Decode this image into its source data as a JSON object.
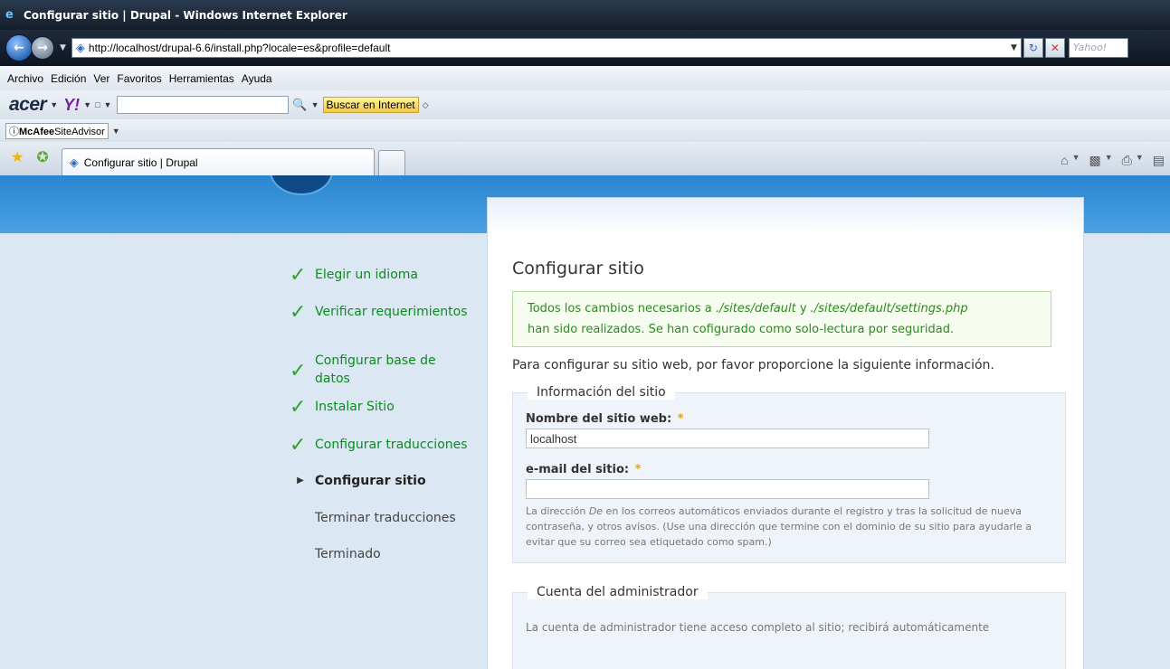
{
  "window": {
    "title": "Configurar sitio | Drupal - Windows Internet Explorer",
    "address": "http://localhost/drupal-6.6/install.php?locale=es&profile=default",
    "search_placeholder": "Yahoo!"
  },
  "menu": {
    "items": [
      "Archivo",
      "Edición",
      "Ver",
      "Favoritos",
      "Herramientas",
      "Ayuda"
    ]
  },
  "toolbar": {
    "acer_label": "acer",
    "yahoo_label": "Y!",
    "search_button": "Buscar en Internet",
    "mcafee_label": "McAfee",
    "mcafee_sub": "SiteAdvisor"
  },
  "tabs": {
    "active_label": "Configurar sitio | Drupal"
  },
  "steps": [
    {
      "label": "Elegir un idioma",
      "state": "done"
    },
    {
      "label": "Verificar requerimientos",
      "state": "done"
    },
    {
      "label": "Configurar base de datos",
      "state": "done"
    },
    {
      "label": "Instalar Sitio",
      "state": "done"
    },
    {
      "label": "Configurar traducciones",
      "state": "done"
    },
    {
      "label": "Configurar sitio",
      "state": "active"
    },
    {
      "label": "Terminar traducciones",
      "state": "pending"
    },
    {
      "label": "Terminado",
      "state": "pending"
    }
  ],
  "content": {
    "heading": "Configurar sitio",
    "status_part1": "Todos los cambios necesarios a ",
    "status_path1": "./sites/default",
    "status_and": " y ",
    "status_path2": "./sites/default/settings.php",
    "status_part2": "han sido realizados. Se han cofigurado como solo-lectura por seguridad.",
    "intro": "Para configurar su sitio web, por favor proporcione la siguiente información.",
    "site_info": {
      "legend": "Información del sitio",
      "name_label": "Nombre del sitio web:",
      "name_value": "localhost",
      "email_label": "e-mail del sitio:",
      "email_value": "",
      "required_mark": "*",
      "desc_part1": "La dirección ",
      "desc_em": "De",
      "desc_part2": " en los correos automáticos enviados durante el registro y tras la solicitud de nueva contraseña, y otros avisos. (Use una dirección que termine con el dominio de su sitio para ayudarle a evitar que su correo sea etiquetado como spam.)"
    },
    "admin": {
      "legend": "Cuenta del administrador",
      "desc": "La cuenta de administrador tiene acceso completo al sitio; recibirá automáticamente"
    }
  }
}
